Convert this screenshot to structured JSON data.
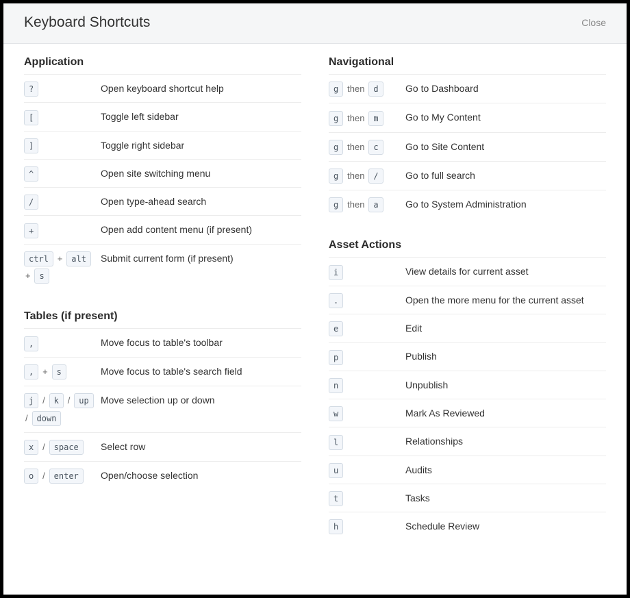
{
  "header": {
    "title": "Keyboard Shortcuts",
    "close": "Close"
  },
  "sections": {
    "application": {
      "title": "Application",
      "rows": [
        {
          "keys": [
            {
              "k": "?"
            }
          ],
          "desc": "Open keyboard shortcut help"
        },
        {
          "keys": [
            {
              "k": "["
            }
          ],
          "desc": "Toggle left sidebar"
        },
        {
          "keys": [
            {
              "k": "]"
            }
          ],
          "desc": "Toggle right sidebar"
        },
        {
          "keys": [
            {
              "k": "^"
            }
          ],
          "desc": "Open site switching menu"
        },
        {
          "keys": [
            {
              "k": "/"
            }
          ],
          "desc": "Open type-ahead search"
        },
        {
          "keys": [
            {
              "k": "+"
            }
          ],
          "desc": "Open add content menu (if present)"
        },
        {
          "keys": [
            {
              "k": "ctrl"
            },
            {
              "sep": "+"
            },
            {
              "k": "alt"
            },
            {
              "sep": "+"
            },
            {
              "k": "s"
            }
          ],
          "desc": "Submit current form (if present)"
        }
      ]
    },
    "navigational": {
      "title": "Navigational",
      "rows": [
        {
          "keys": [
            {
              "k": "g"
            },
            {
              "sep": "then"
            },
            {
              "k": "d"
            }
          ],
          "desc": "Go to Dashboard"
        },
        {
          "keys": [
            {
              "k": "g"
            },
            {
              "sep": "then"
            },
            {
              "k": "m"
            }
          ],
          "desc": "Go to My Content"
        },
        {
          "keys": [
            {
              "k": "g"
            },
            {
              "sep": "then"
            },
            {
              "k": "c"
            }
          ],
          "desc": "Go to Site Content"
        },
        {
          "keys": [
            {
              "k": "g"
            },
            {
              "sep": "then"
            },
            {
              "k": "/"
            }
          ],
          "desc": "Go to full search"
        },
        {
          "keys": [
            {
              "k": "g"
            },
            {
              "sep": "then"
            },
            {
              "k": "a"
            }
          ],
          "desc": "Go to System Administration"
        }
      ]
    },
    "tables": {
      "title": "Tables (if present)",
      "rows": [
        {
          "keys": [
            {
              "k": ","
            }
          ],
          "desc": "Move focus to table's toolbar"
        },
        {
          "keys": [
            {
              "k": ","
            },
            {
              "sep": "+"
            },
            {
              "k": "s"
            }
          ],
          "desc": "Move focus to table's search field"
        },
        {
          "keys": [
            {
              "k": "j"
            },
            {
              "sep": "/"
            },
            {
              "k": "k"
            },
            {
              "sep": "/"
            },
            {
              "k": "up"
            },
            {
              "sep": "/"
            },
            {
              "k": "down"
            }
          ],
          "desc": "Move selection up or down"
        },
        {
          "keys": [
            {
              "k": "x"
            },
            {
              "sep": "/"
            },
            {
              "k": "space"
            }
          ],
          "desc": "Select row"
        },
        {
          "keys": [
            {
              "k": "o"
            },
            {
              "sep": "/"
            },
            {
              "k": "enter"
            }
          ],
          "desc": "Open/choose selection"
        }
      ]
    },
    "asset": {
      "title": "Asset Actions",
      "rows": [
        {
          "keys": [
            {
              "k": "i"
            }
          ],
          "desc": "View details for current asset"
        },
        {
          "keys": [
            {
              "k": "."
            }
          ],
          "desc": "Open the more menu for the current asset"
        },
        {
          "keys": [
            {
              "k": "e"
            }
          ],
          "desc": "Edit"
        },
        {
          "keys": [
            {
              "k": "p"
            }
          ],
          "desc": "Publish"
        },
        {
          "keys": [
            {
              "k": "n"
            }
          ],
          "desc": "Unpublish"
        },
        {
          "keys": [
            {
              "k": "w"
            }
          ],
          "desc": "Mark As Reviewed"
        },
        {
          "keys": [
            {
              "k": "l"
            }
          ],
          "desc": "Relationships"
        },
        {
          "keys": [
            {
              "k": "u"
            }
          ],
          "desc": "Audits"
        },
        {
          "keys": [
            {
              "k": "t"
            }
          ],
          "desc": "Tasks"
        },
        {
          "keys": [
            {
              "k": "h"
            }
          ],
          "desc": "Schedule Review"
        }
      ]
    }
  }
}
